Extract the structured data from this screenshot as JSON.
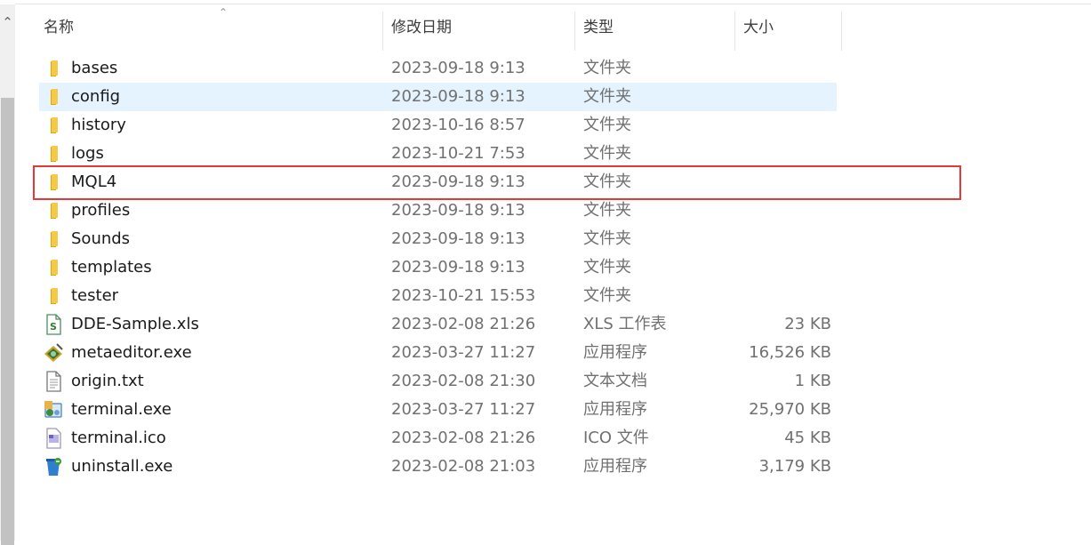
{
  "columns": {
    "name": "名称",
    "date": "修改日期",
    "type": "类型",
    "size": "大小"
  },
  "files": [
    {
      "name": "bases",
      "date": "2023-09-18 9:13",
      "type": "文件夹",
      "size": "",
      "icon": "folder-icon"
    },
    {
      "name": "config",
      "date": "2023-09-18 9:13",
      "type": "文件夹",
      "size": "",
      "icon": "folder-icon",
      "selected": true
    },
    {
      "name": "history",
      "date": "2023-10-16 8:57",
      "type": "文件夹",
      "size": "",
      "icon": "folder-icon"
    },
    {
      "name": "logs",
      "date": "2023-10-21 7:53",
      "type": "文件夹",
      "size": "",
      "icon": "folder-icon"
    },
    {
      "name": "MQL4",
      "date": "2023-09-18 9:13",
      "type": "文件夹",
      "size": "",
      "icon": "folder-icon",
      "highlighted": true
    },
    {
      "name": "profiles",
      "date": "2023-09-18 9:13",
      "type": "文件夹",
      "size": "",
      "icon": "folder-icon"
    },
    {
      "name": "Sounds",
      "date": "2023-09-18 9:13",
      "type": "文件夹",
      "size": "",
      "icon": "folder-icon"
    },
    {
      "name": "templates",
      "date": "2023-09-18 9:13",
      "type": "文件夹",
      "size": "",
      "icon": "folder-icon"
    },
    {
      "name": "tester",
      "date": "2023-10-21 15:53",
      "type": "文件夹",
      "size": "",
      "icon": "folder-icon"
    },
    {
      "name": "DDE-Sample.xls",
      "date": "2023-02-08 21:26",
      "type": "XLS 工作表",
      "size": "23 KB",
      "icon": "spreadsheet-icon"
    },
    {
      "name": "metaeditor.exe",
      "date": "2023-03-27 11:27",
      "type": "应用程序",
      "size": "16,526 KB",
      "icon": "metaeditor-app-icon"
    },
    {
      "name": "origin.txt",
      "date": "2023-02-08 21:30",
      "type": "文本文档",
      "size": "1 KB",
      "icon": "text-file-icon"
    },
    {
      "name": "terminal.exe",
      "date": "2023-03-27 11:27",
      "type": "应用程序",
      "size": "25,970 KB",
      "icon": "terminal-app-icon"
    },
    {
      "name": "terminal.ico",
      "date": "2023-02-08 21:26",
      "type": "ICO 文件",
      "size": "45 KB",
      "icon": "ico-file-icon"
    },
    {
      "name": "uninstall.exe",
      "date": "2023-02-08 21:03",
      "type": "应用程序",
      "size": "3,179 KB",
      "icon": "uninstall-app-icon"
    }
  ],
  "colors": {
    "selected_row": "#e5f3ff",
    "highlight_border": "#e53935",
    "folder": "#f7c948"
  }
}
